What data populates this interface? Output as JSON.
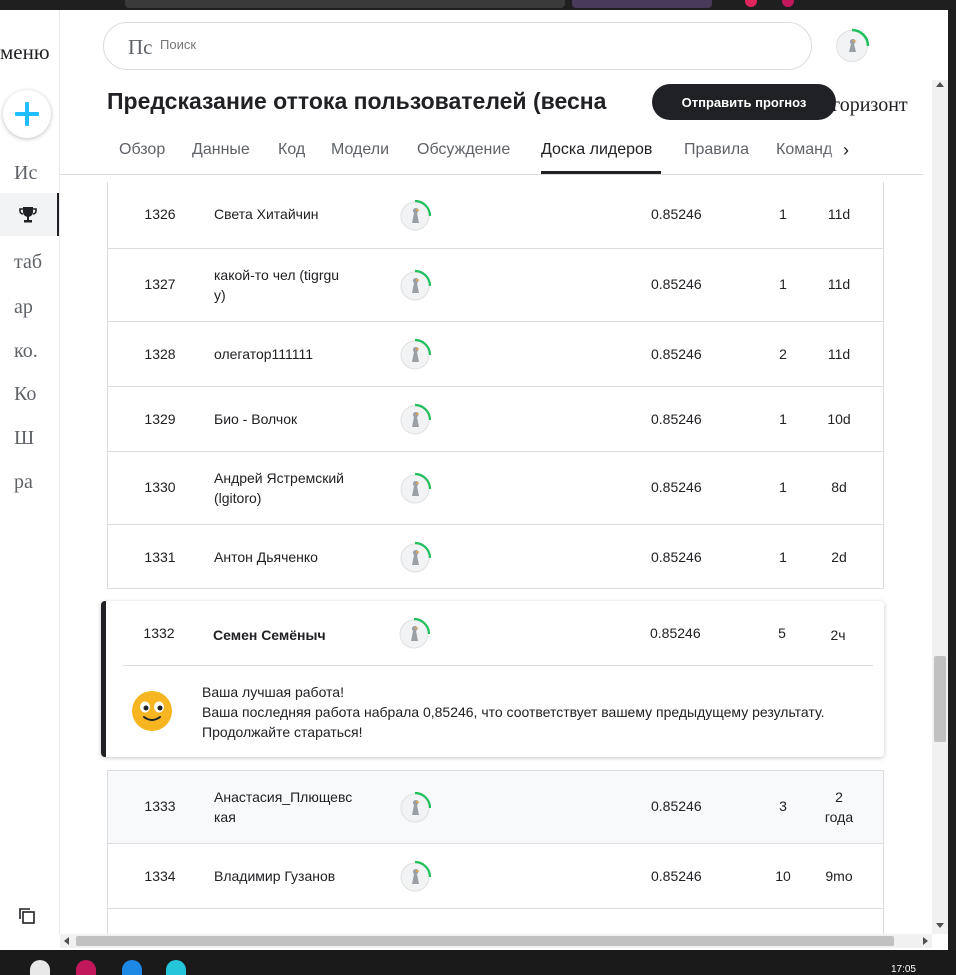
{
  "sidebar": {
    "menu_label": "меню",
    "items": [
      "Ис",
      "таб",
      "ар",
      "ко.",
      "Ко",
      "Ш",
      "ра"
    ]
  },
  "search": {
    "glyph": "Пс",
    "placeholder": "Поиск"
  },
  "header": {
    "title": "Предсказание оттока пользователей (весна",
    "title_suffix": "_горизонт",
    "submit_label": "Отправить прогноз"
  },
  "tabs": [
    {
      "label": "Обзор"
    },
    {
      "label": "Данные"
    },
    {
      "label": "Код"
    },
    {
      "label": "Модели"
    },
    {
      "label": "Обсуждение"
    },
    {
      "label": "Доска лидеров"
    },
    {
      "label": "Правила"
    },
    {
      "label": "Команд"
    }
  ],
  "leaderboard": {
    "rows_before": [
      {
        "rank": "1326",
        "name": "Света Хитайчин",
        "score": "0.85246",
        "entries": "1",
        "last": "11d"
      },
      {
        "rank": "1327",
        "name": "какой-то чел (tigrgu y)",
        "score": "0.85246",
        "entries": "1",
        "last": "11d"
      },
      {
        "rank": "1328",
        "name": "олегатор111111",
        "score": "0.85246",
        "entries": "2",
        "last": "11d"
      },
      {
        "rank": "1329",
        "name": "Био - Волчок",
        "score": "0.85246",
        "entries": "1",
        "last": "10d"
      },
      {
        "rank": "1330",
        "name": "Андрей Ястремский (lgitoro)",
        "score": "0.85246",
        "entries": "1",
        "last": "8d"
      },
      {
        "rank": "1331",
        "name": "Антон Дьяченко",
        "score": "0.85246",
        "entries": "1",
        "last": "2d"
      }
    ],
    "me": {
      "rank": "1332",
      "name": "Семен Семёныч",
      "score": "0.85246",
      "entries": "5",
      "last": "2ч",
      "msg_title": "Ваша лучшая работа!",
      "msg_line2": "Ваша последняя работа набрала 0,85246, что соответствует вашему предыдущему результату.",
      "msg_line3": "Продолжайте стараться!"
    },
    "rows_after": [
      {
        "rank": "1333",
        "name": "Анастасия_Плющевс кая",
        "score": "0.85246",
        "entries": "3",
        "last": "2 года"
      },
      {
        "rank": "1334",
        "name": "Владимир Гузанов",
        "score": "0.85246",
        "entries": "10",
        "last": "9mo"
      }
    ]
  },
  "taskbar": {
    "clock": "17:05"
  }
}
